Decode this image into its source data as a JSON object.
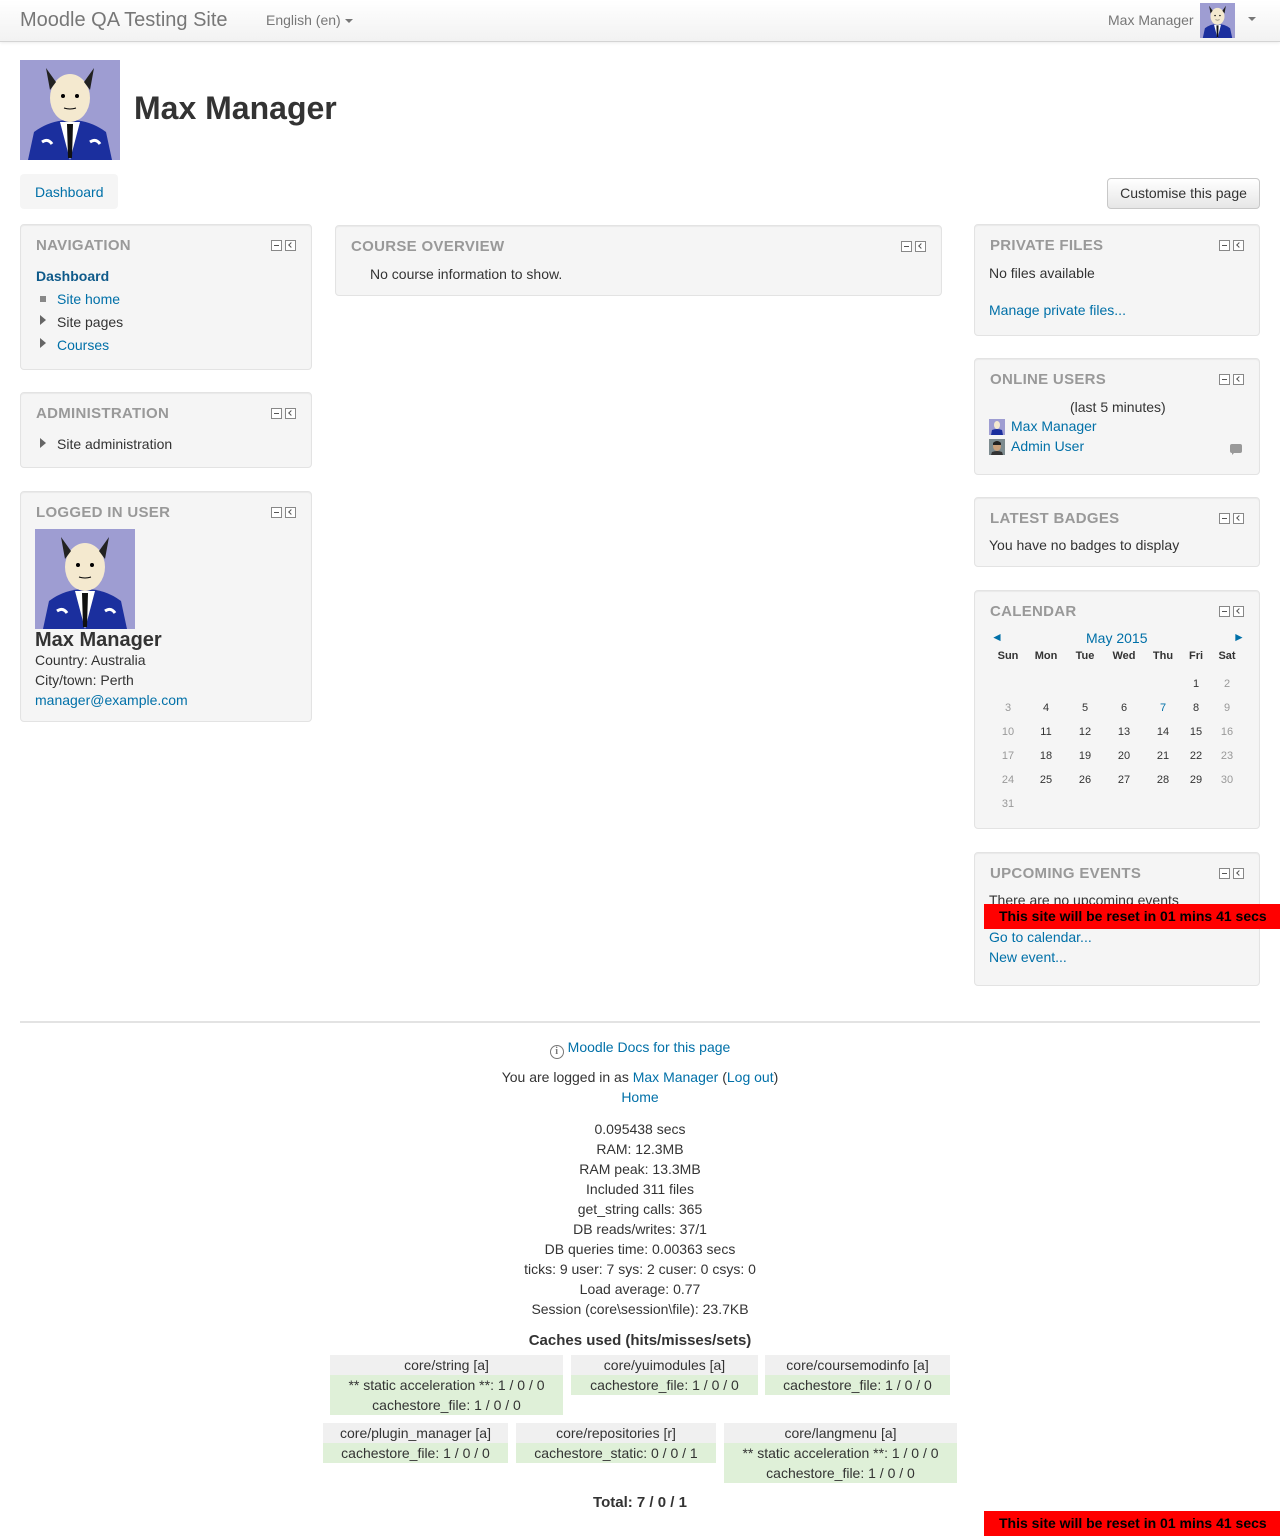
{
  "navbar": {
    "brand": "Moodle QA Testing Site",
    "language": "English (en)",
    "user_name": "Max Manager"
  },
  "page": {
    "title": "Max Manager",
    "breadcrumb": "Dashboard",
    "customise_button": "Customise this page"
  },
  "navigation": {
    "title": "NAVIGATION",
    "dashboard": "Dashboard",
    "items": [
      {
        "label": "Site home"
      },
      {
        "label": "Site pages"
      },
      {
        "label": "Courses"
      }
    ]
  },
  "administration": {
    "title": "ADMINISTRATION",
    "item": "Site administration"
  },
  "logged_in_user": {
    "title": "LOGGED IN USER",
    "name": "Max Manager",
    "country": "Country: Australia",
    "city": "City/town: Perth",
    "email": "manager@example.com"
  },
  "course_overview": {
    "title": "COURSE OVERVIEW",
    "message": "No course information to show."
  },
  "private_files": {
    "title": "PRIVATE FILES",
    "message": "No files available",
    "manage_link": "Manage private files..."
  },
  "online_users": {
    "title": "ONLINE USERS",
    "subtitle": "(last 5 minutes)",
    "users": [
      {
        "name": "Max Manager"
      },
      {
        "name": "Admin User"
      }
    ]
  },
  "latest_badges": {
    "title": "LATEST BADGES",
    "message": "You have no badges to display"
  },
  "calendar": {
    "title": "CALENDAR",
    "month": "May 2015",
    "prev": "◄",
    "next": "►",
    "days": [
      "Sun",
      "Mon",
      "Tue",
      "Wed",
      "Thu",
      "Fri",
      "Sat"
    ],
    "weeks": [
      [
        "",
        "",
        "",
        "",
        "",
        "1",
        "2"
      ],
      [
        "3",
        "4",
        "5",
        "6",
        "7",
        "8",
        "9"
      ],
      [
        "10",
        "11",
        "12",
        "13",
        "14",
        "15",
        "16"
      ],
      [
        "17",
        "18",
        "19",
        "20",
        "21",
        "22",
        "23"
      ],
      [
        "24",
        "25",
        "26",
        "27",
        "28",
        "29",
        "30"
      ],
      [
        "31",
        "",
        "",
        "",
        "",
        "",
        ""
      ]
    ],
    "today": "7"
  },
  "upcoming_events": {
    "title": "UPCOMING EVENTS",
    "message": "There are no upcoming events",
    "go_to_calendar": "Go to calendar...",
    "new_event": "New event..."
  },
  "reset_notice": "This site will be reset in 01 mins 41 secs",
  "footer": {
    "docs_link": "Moodle Docs for this page",
    "logged_in_prefix": "You are logged in as ",
    "logged_in_user": "Max Manager",
    "logout_open": " (",
    "logout": "Log out",
    "logout_close": ")",
    "home": "Home",
    "perf": [
      "0.095438 secs",
      "RAM: 12.3MB",
      "RAM peak: 13.3MB",
      "Included 311 files",
      "get_string calls: 365",
      "DB reads/writes: 37/1",
      "DB queries time: 0.00363 secs",
      "ticks: 9 user: 7 sys: 2 cuser: 0 csys: 0",
      "Load average: 0.77",
      "Session (core\\session\\file): 23.7KB"
    ],
    "caches_title": "Caches used (hits/misses/sets)",
    "caches": [
      {
        "name": "core/string [a]",
        "rows": [
          "** static acceleration **: 1 / 0 / 0",
          "cachestore_file: 1 / 0 / 0"
        ]
      },
      {
        "name": "core/yuimodules [a]",
        "rows": [
          "cachestore_file: 1 / 0 / 0"
        ]
      },
      {
        "name": "core/coursemodinfo [a]",
        "rows": [
          "cachestore_file: 1 / 0 / 0"
        ]
      },
      {
        "name": "core/plugin_manager [a]",
        "rows": [
          "cachestore_file: 1 / 0 / 0"
        ]
      },
      {
        "name": "core/repositories [r]",
        "rows": [
          "cachestore_static: 0 / 0 / 1"
        ]
      },
      {
        "name": "core/langmenu [a]",
        "rows": [
          "** static acceleration **: 1 / 0 / 0",
          "cachestore_file: 1 / 0 / 0"
        ]
      }
    ],
    "total": "Total: 7 / 0 / 1"
  }
}
